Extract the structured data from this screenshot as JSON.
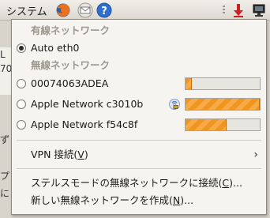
{
  "panel": {
    "menu_label": "システム",
    "icons": [
      "firefox-icon",
      "mail-icon",
      "help-icon",
      "update-icon",
      "network-icon"
    ]
  },
  "background": {
    "fragment_1": "L",
    "fragment_2": "70",
    "fragment_3": "ず",
    "fragment_4": "プ",
    "fragment_5": "に"
  },
  "menu": {
    "wired_heading": "有線ネットワーク",
    "wired_items": [
      {
        "label": "Auto eth0",
        "selected": true
      }
    ],
    "wireless_heading": "無線ネットワーク",
    "wireless_items": [
      {
        "label": "00074063ADEA",
        "signal": 0.08,
        "secure": false
      },
      {
        "label": "Apple Network c3010b",
        "signal": 1.0,
        "secure": true
      },
      {
        "label": "Apple Network f54c8f",
        "signal": 0.55,
        "secure": false
      }
    ],
    "vpn": {
      "label": "VPN 接続(",
      "accel": "V",
      "suffix": ")"
    },
    "stealth": {
      "label": "ステルスモードの無線ネットワークに接続(",
      "accel": "C",
      "suffix": ")..."
    },
    "new_wireless": {
      "label": "新しい無線ネットワークを作成(",
      "accel": "N",
      "suffix": ")..."
    }
  },
  "colors": {
    "signal_fill": "#f0951e",
    "menu_bg": "#f6f4f0"
  }
}
